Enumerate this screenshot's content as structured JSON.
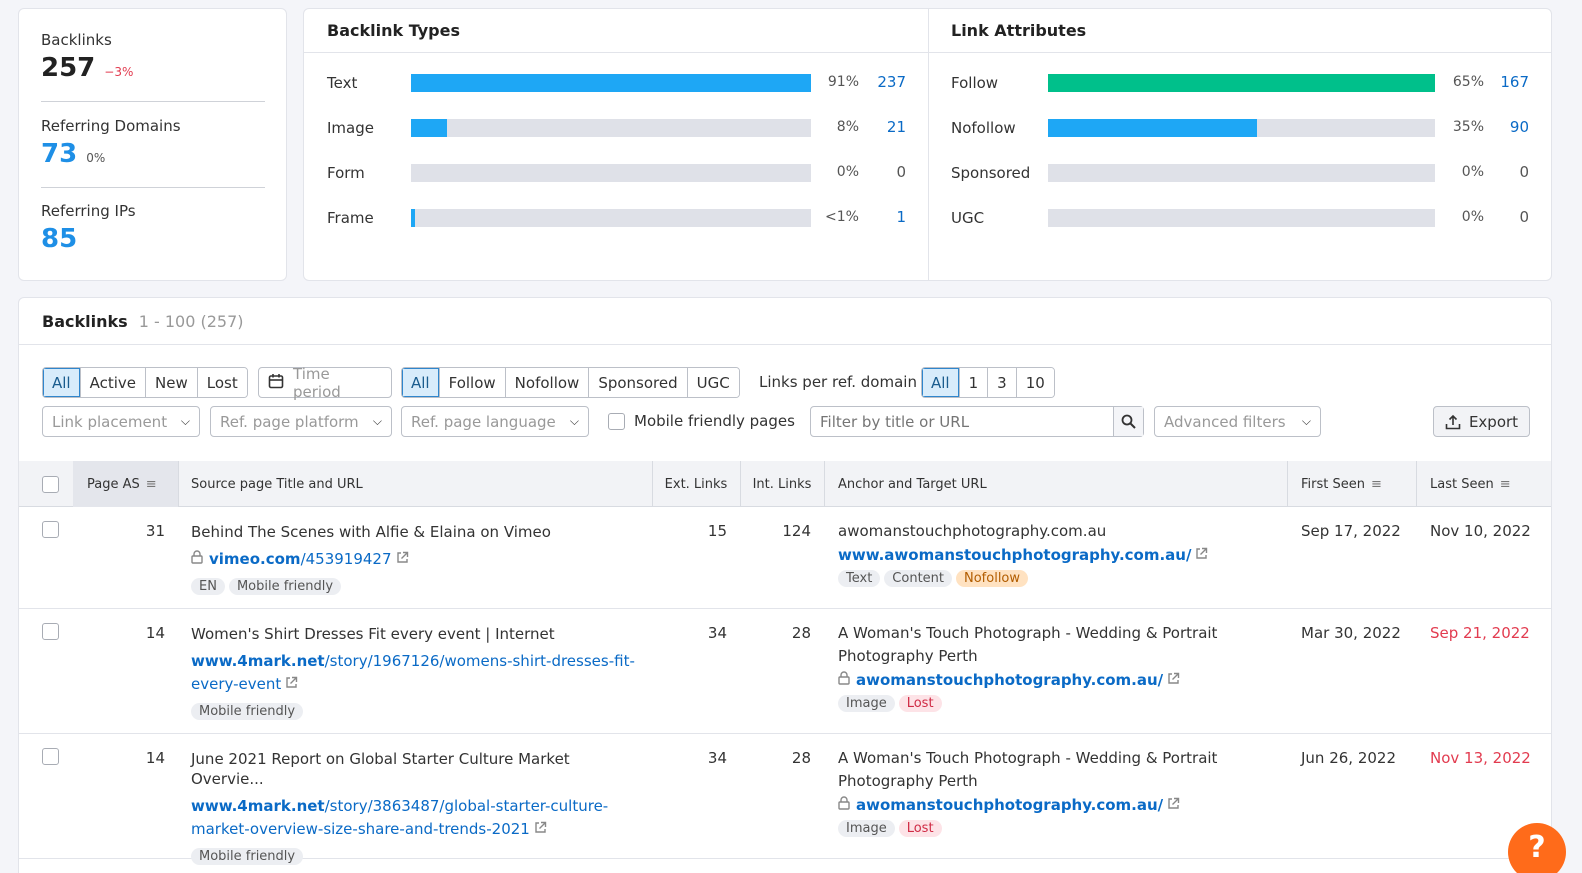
{
  "summary": {
    "backlinks": {
      "label": "Backlinks",
      "value": "257",
      "change": "−3%"
    },
    "domains": {
      "label": "Referring Domains",
      "value": "73",
      "change": "0%"
    },
    "ips": {
      "label": "Referring IPs",
      "value": "85"
    }
  },
  "backlink_types": {
    "title": "Backlink Types",
    "rows": [
      {
        "label": "Text",
        "pct": "91%",
        "count": "237",
        "fill": 1.0
      },
      {
        "label": "Image",
        "pct": "8%",
        "count": "21",
        "fill": 0.09
      },
      {
        "label": "Form",
        "pct": "0%",
        "count": "0",
        "fill": 0
      },
      {
        "label": "Frame",
        "pct": "<1%",
        "count": "1",
        "fill": 0.01
      }
    ]
  },
  "link_attributes": {
    "title": "Link Attributes",
    "rows": [
      {
        "label": "Follow",
        "pct": "65%",
        "count": "167",
        "fill": 1.0
      },
      {
        "label": "Nofollow",
        "pct": "35%",
        "count": "90",
        "fill": 0.54
      },
      {
        "label": "Sponsored",
        "pct": "0%",
        "count": "0",
        "fill": 0
      },
      {
        "label": "UGC",
        "pct": "0%",
        "count": "0",
        "fill": 0
      }
    ]
  },
  "table": {
    "title": "Backlinks",
    "count": "1 - 100 (257)",
    "status_filters": [
      "All",
      "Active",
      "New",
      "Lost"
    ],
    "time_period": "Time period",
    "attr_filters": [
      "All",
      "Follow",
      "Nofollow",
      "Sponsored",
      "UGC"
    ],
    "links_per_domain_label": "Links per ref. domain",
    "links_per_domain": [
      "All",
      "1",
      "3",
      "10"
    ],
    "link_placement": "Link placement",
    "ref_platform": "Ref. page platform",
    "ref_language": "Ref. page language",
    "mobile_friendly": "Mobile friendly pages",
    "search_placeholder": "Filter by title or URL",
    "advanced_filters": "Advanced filters",
    "export": "Export",
    "columns": {
      "page_as": "Page AS",
      "source": "Source page Title and URL",
      "ext": "Ext. Links",
      "int": "Int. Links",
      "anchor": "Anchor and Target URL",
      "first_seen": "First Seen",
      "last_seen": "Last Seen"
    },
    "rows": [
      {
        "as": "31",
        "title": "Behind The Scenes with Alfie & Elaina on Vimeo",
        "url_domain": "vimeo.com",
        "url_path": "/453919427",
        "source_tags": [
          "EN",
          "Mobile friendly"
        ],
        "ext": "15",
        "int": "124",
        "anchor": "awomanstouchphotography.com.au",
        "target": "www.awomanstouchphotography.com.au/",
        "target_tags": [
          "Text",
          "Content",
          "Nofollow"
        ],
        "first_seen": "Sep 17, 2022",
        "last_seen": "Nov 10, 2022",
        "last_seen_color": "#333333"
      },
      {
        "as": "14",
        "title": "Women's Shirt Dresses Fit every event | Internet",
        "url_domain": "www.4mark.net",
        "url_path": "/story/1967126/womens-shirt-dresses-fit-every-event",
        "source_tags": [
          "Mobile friendly"
        ],
        "ext": "34",
        "int": "28",
        "anchor": "A Woman's Touch Photograph - Wedding & Portrait Photography Perth",
        "target": "awomanstouchphotography.com.au/",
        "target_tags": [
          "Image",
          "Lost"
        ],
        "first_seen": "Mar 30, 2022",
        "last_seen": "Sep 21, 2022",
        "last_seen_color": "#e23b4f"
      },
      {
        "as": "14",
        "title": "June 2021 Report on Global Starter Culture Market Overvie...",
        "url_domain": "www.4mark.net",
        "url_path": "/story/3863487/global-starter-culture-market-overview-size-share-and-trends-2021",
        "source_tags": [
          "Mobile friendly"
        ],
        "ext": "34",
        "int": "28",
        "anchor": "A Woman's Touch Photograph - Wedding & Portrait Photography Perth",
        "target": "awomanstouchphotography.com.au/",
        "target_tags": [
          "Image",
          "Lost"
        ],
        "first_seen": "Jun 26, 2022",
        "last_seen": "Nov 13, 2022",
        "last_seen_color": "#e23b4f"
      }
    ]
  },
  "help_label": "?",
  "colors": {
    "blue": "#1ea7f5",
    "green": "#00c08b",
    "link": "#0a6ac6",
    "negative": "#e23b4f",
    "accent_orange": "#ff6b1a"
  }
}
